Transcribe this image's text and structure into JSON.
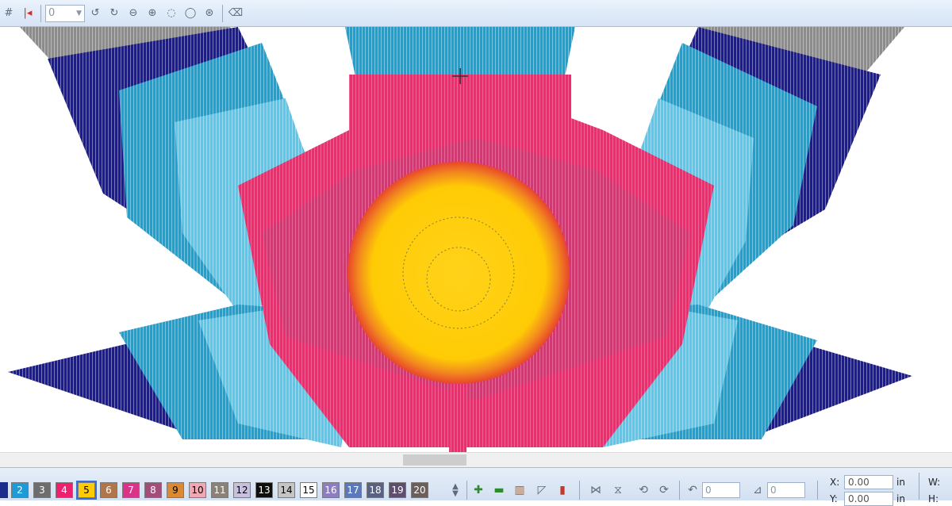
{
  "toolbar": {
    "stitch_count_value": "0",
    "icons": [
      "grid-icon",
      "first-stitch-icon",
      "spin-input",
      "reduce-icon",
      "increase-icon",
      "fill-ccw-icon",
      "fill-cw-icon",
      "rotate-left-icon",
      "rotate-right-icon",
      "3d-view-icon",
      "eraser-icon"
    ]
  },
  "design": {
    "colors": {
      "navy": "#1c1c8f",
      "gray": "#8c8c8c",
      "cyan": "#1fa0cf",
      "lightcyan": "#5ec6e8",
      "pink": "#ee2d6f",
      "rose": "#c43c76",
      "yellow": "#ffcb05",
      "orange": "#f28b1e"
    }
  },
  "palette": {
    "swatches": [
      {
        "label": "2",
        "color": "#1e9bd7",
        "text": "#ffffff"
      },
      {
        "label": "3",
        "color": "#6d6d6d",
        "text": "#ffffff"
      },
      {
        "label": "4",
        "color": "#ee1f6e",
        "text": "#ffffff"
      },
      {
        "label": "5",
        "color": "#ffcb05",
        "text": "#000000"
      },
      {
        "label": "6",
        "color": "#b0764a",
        "text": "#ffffff"
      },
      {
        "label": "7",
        "color": "#d9338a",
        "text": "#ffffff"
      },
      {
        "label": "8",
        "color": "#a34d7a",
        "text": "#ffffff"
      },
      {
        "label": "9",
        "color": "#d98a32",
        "text": "#000000"
      },
      {
        "label": "10",
        "color": "#f0a9b4",
        "text": "#000000"
      },
      {
        "label": "11",
        "color": "#8a8278",
        "text": "#ffffff"
      },
      {
        "label": "12",
        "color": "#c7c0df",
        "text": "#000000"
      },
      {
        "label": "13",
        "color": "#0e0e0e",
        "text": "#ffffff"
      },
      {
        "label": "14",
        "color": "#c5c5c5",
        "text": "#000000"
      },
      {
        "label": "15",
        "color": "#ffffff",
        "text": "#000000"
      },
      {
        "label": "16",
        "color": "#8d7fbf",
        "text": "#ffffff"
      },
      {
        "label": "17",
        "color": "#5c78b8",
        "text": "#ffffff"
      },
      {
        "label": "18",
        "color": "#5a6280",
        "text": "#ffffff"
      },
      {
        "label": "19",
        "color": "#5e4f6e",
        "text": "#ffffff"
      },
      {
        "label": "20",
        "color": "#6b5f5c",
        "text": "#ffffff"
      }
    ]
  },
  "bottom": {
    "rotate_value": "0",
    "slant_value": "0",
    "x_label": "X:",
    "x_value": "0.00",
    "x_unit": "in",
    "y_label": "Y:",
    "y_value": "0.00",
    "y_unit": "in",
    "w_label": "W:",
    "h_label": "H:"
  }
}
